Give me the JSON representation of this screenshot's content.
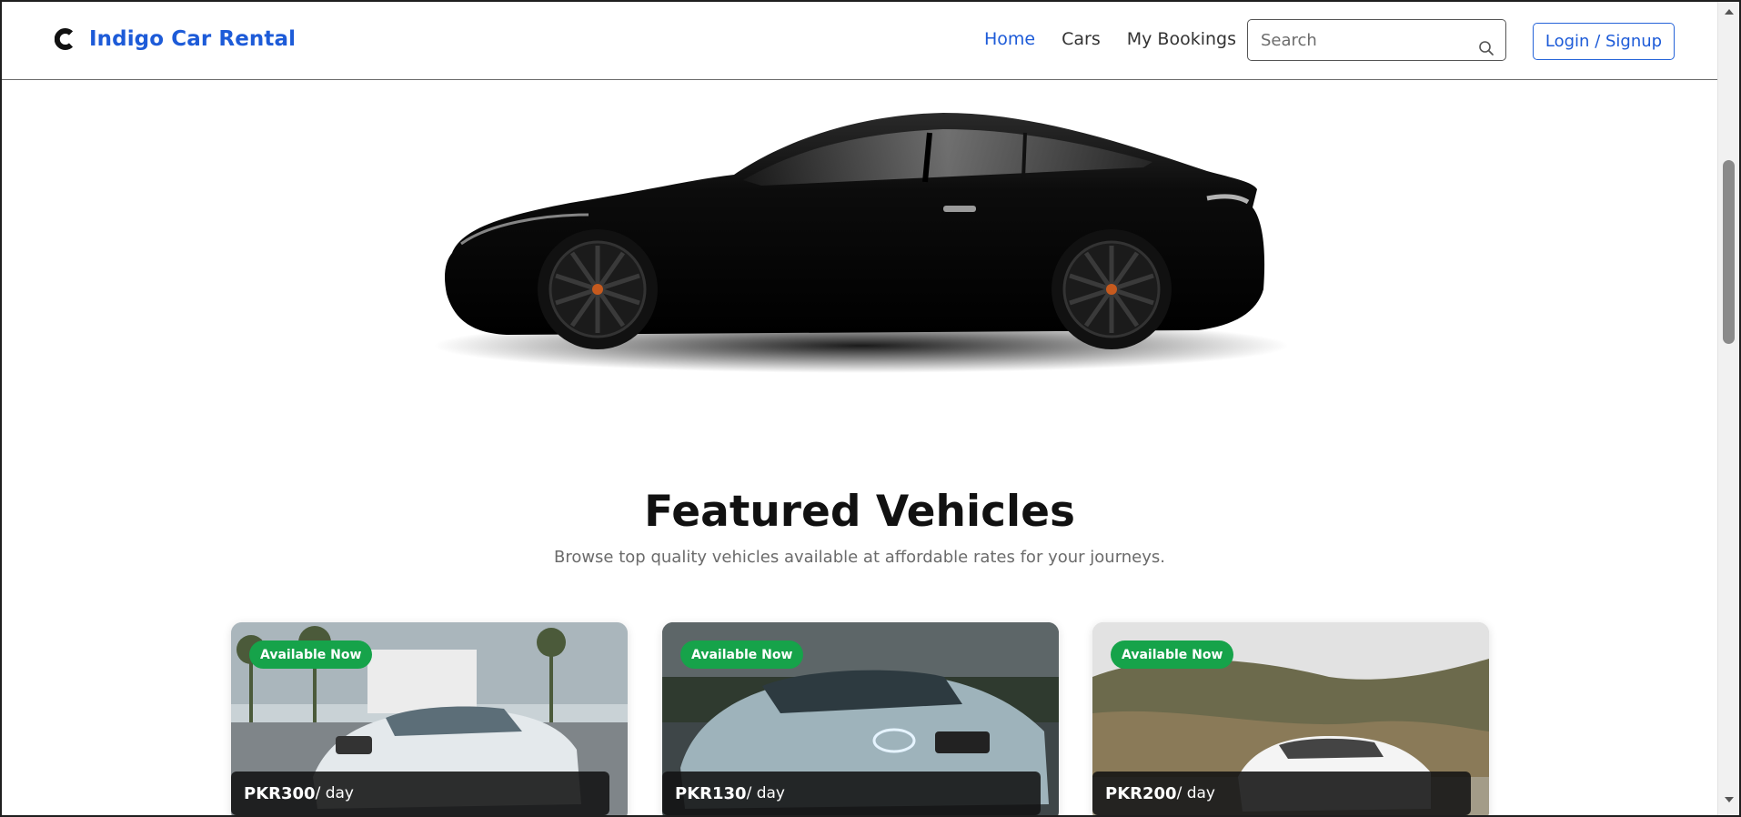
{
  "navbar": {
    "brand_name": "Indigo Car Rental",
    "links": [
      "Home",
      "Cars",
      "My Bookings"
    ],
    "active_link": "Home",
    "search_placeholder": "Search",
    "login_label": "Login / Signup"
  },
  "featured": {
    "title": "Featured Vehicles",
    "subtitle": "Browse top quality vehicles available at affordable rates for your journeys."
  },
  "cars": [
    {
      "badge": "Available Now",
      "price": "PKR300",
      "unit": "/ day",
      "color": "#e9eef2"
    },
    {
      "badge": "Available Now",
      "price": "PKR130",
      "unit": "/ day",
      "color": "#8fa5ad"
    },
    {
      "badge": "Available Now",
      "price": "PKR200",
      "unit": "/ day",
      "color": "#f3f3f3"
    }
  ],
  "colors": {
    "brand": "#1d5bd8",
    "badge": "#16a34a"
  },
  "icons": [
    "brand-c-icon",
    "search-icon",
    "scroll-up-icon",
    "scroll-down-icon"
  ]
}
